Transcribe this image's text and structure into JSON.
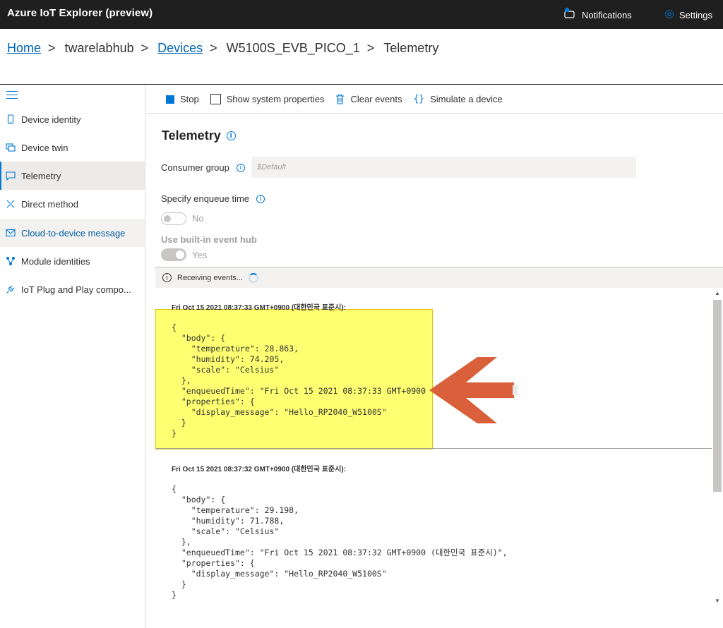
{
  "app": {
    "title": "Azure IoT Explorer (preview)",
    "notifications_label": "Notifications",
    "settings_label": "Settings",
    "accent_color": "#0078d4"
  },
  "breadcrumb": {
    "items": [
      "Home",
      "twarelabhub",
      "Devices",
      "W5100S_EVB_PICO_1",
      "Telemetry"
    ],
    "separator": ">"
  },
  "sidebar": {
    "items": [
      {
        "label": "Device identity",
        "icon": "device-icon"
      },
      {
        "label": "Device twin",
        "icon": "twin-icon"
      },
      {
        "label": "Telemetry",
        "icon": "chat-icon",
        "active": true
      },
      {
        "label": "Direct method",
        "icon": "method-icon"
      },
      {
        "label": "Cloud-to-device message",
        "icon": "mail-icon"
      },
      {
        "label": "Module identities",
        "icon": "modules-icon"
      },
      {
        "label": "IoT Plug and Play compo...",
        "icon": "plug-icon"
      }
    ]
  },
  "toolbar": {
    "stop_label": "Stop",
    "show_system_label": "Show system properties",
    "clear_label": "Clear events",
    "simulate_label": "Simulate a device"
  },
  "main": {
    "title": "Telemetry",
    "consumer_group_label": "Consumer group",
    "consumer_group_value": "$Default",
    "enqueue_label": "Specify enqueue time",
    "enqueue_toggle_text": "No",
    "builtin_label": "Use built-in event hub",
    "builtin_toggle_text": "Yes",
    "status_text": "Receiving events..."
  },
  "events": [
    {
      "time": "Fri Oct 15 2021 08:37:33 GMT+0900 (대한민국 표준시):",
      "json": "{\n  \"body\": {\n    \"temperature\": 28.863,\n    \"humidity\": 74.205,\n    \"scale\": \"Celsius\"\n  },\n  \"enqueuedTime\": \"Fri Oct 15 2021 08:37:33 GMT+0900\n  \"properties\": {\n    \"display_message\": \"Hello_RP2040_W5100S\"\n  }\n}"
    },
    {
      "time": "Fri Oct 15 2021 08:37:32 GMT+0900 (대한민국 표준시):",
      "json": "{\n  \"body\": {\n    \"temperature\": 29.198,\n    \"humidity\": 71.788,\n    \"scale\": \"Celsius\"\n  },\n  \"enqueuedTime\": \"Fri Oct 15 2021 08:37:32 GMT+0900 (대한민국 표준시)\",\n  \"properties\": {\n    \"display_message\": \"Hello_RP2040_W5100S\"\n  }\n}"
    }
  ],
  "annotation": {
    "highlight_color": "#ffff3c",
    "arrow_color": "#d9603b"
  }
}
